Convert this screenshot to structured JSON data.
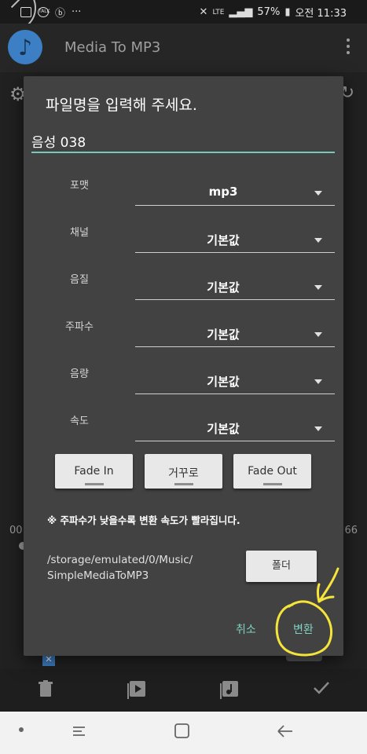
{
  "status_bar": {
    "battery": "57%",
    "clock": "오전 11:33",
    "carrier": "LTE",
    "more_dots": "···",
    "talk_badge": "TALK"
  },
  "app_bar": {
    "title": "Media To MP3"
  },
  "background": {
    "time_left": "00",
    "time_right": "66"
  },
  "dialog": {
    "title": "파일명을 입력해 주세요.",
    "filename_value": "음성 038",
    "options": [
      {
        "label": "포맷",
        "value": "mp3"
      },
      {
        "label": "채널",
        "value": "기본값"
      },
      {
        "label": "음질",
        "value": "기본값"
      },
      {
        "label": "주파수",
        "value": "기본값"
      },
      {
        "label": "음량",
        "value": "기본값"
      },
      {
        "label": "속도",
        "value": "기본값"
      }
    ],
    "effects": {
      "fade_in": "Fade In",
      "reverse": "거꾸로",
      "fade_out": "Fade Out"
    },
    "note": "※ 주파수가 낮을수록 변환 속도가 빨라집니다.",
    "path_line1": "/storage/emulated/0/Music/",
    "path_line2": "SimpleMediaToMP3",
    "folder_button": "폴더",
    "cancel_button": "취소",
    "convert_button": "변환"
  },
  "icons": {
    "settings": "gear-icon",
    "refresh": "refresh-icon",
    "delete": "trash-icon",
    "play": "play-icon",
    "library": "music-library-icon",
    "confirm": "check-icon"
  },
  "colors": {
    "accent": "#7ac8b8",
    "dialog_bg": "#424242",
    "annotation": "#f5e43a",
    "app_icon": "#3d7fc4"
  }
}
